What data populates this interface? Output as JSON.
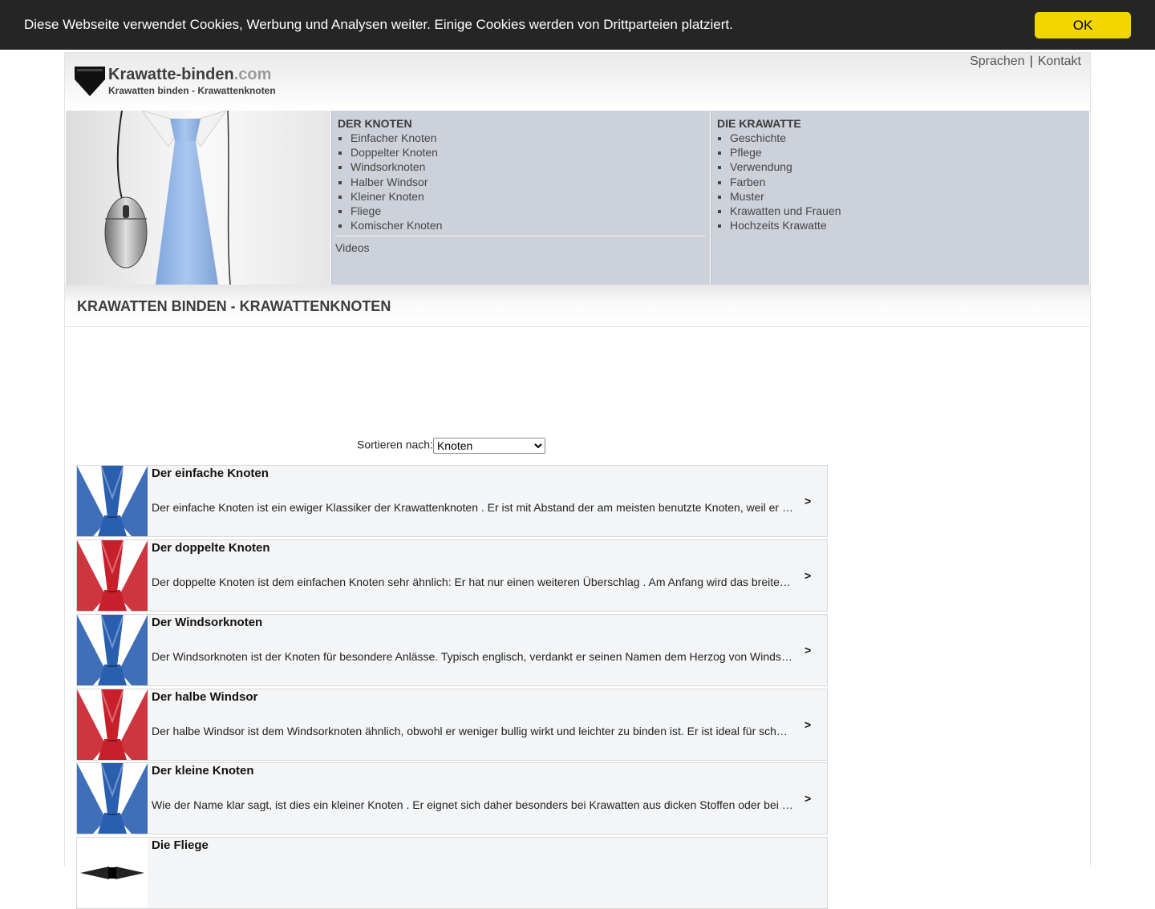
{
  "cookie": {
    "message": "Diese Webseite verwendet Cookies, Werbung und Analysen weiter. Einige Cookies werden von Drittparteien platziert.",
    "ok_label": "OK"
  },
  "header": {
    "site_name": "Krawatte-binden",
    "site_tld": ".com",
    "tagline": "Krawatten binden - Krawattenknoten",
    "links": {
      "languages": "Sprachen",
      "separator": "|",
      "contact": "Kontakt"
    }
  },
  "nav": {
    "knoten": {
      "title": "DER KNOTEN",
      "items": [
        "Einfacher Knoten",
        "Doppelter Knoten",
        "Windsorknoten",
        "Halber Windsor",
        "Kleiner Knoten",
        "Fliege",
        "Komischer Knoten"
      ],
      "videos": "Videos"
    },
    "krawatte": {
      "title": "DIE KRAWATTE",
      "items": [
        "Geschichte",
        "Pflege",
        "Verwendung",
        "Farben",
        "Muster",
        "Krawatten und Frauen",
        "Hochzeits Krawatte"
      ]
    }
  },
  "main": {
    "title": "KRAWATTEN BINDEN - KRAWATTENKNOTEN",
    "sort": {
      "label": "Sortieren nach:",
      "selected": "Knoten"
    },
    "arrow": ">",
    "cards": [
      {
        "title": "Der einfache Knoten",
        "desc": "Der einfache Knoten ist ein ewiger Klassiker der Krawattenknoten . Er ist mit Abstand der am meisten benutzte Knoten, weil er einfach zu binden ist.",
        "color": "#2a5fb0"
      },
      {
        "title": "Der doppelte Knoten",
        "desc": "Der doppelte Knoten ist dem einfachen Knoten sehr ähnlich: Er hat nur einen weiteren Überschlag . Am Anfang wird das breite Ende umgeschlagen.",
        "color": "#c8202a"
      },
      {
        "title": "Der Windsorknoten",
        "desc": "Der Windsorknoten ist der Knoten für besondere Anlässe. Typisch englisch, verdankt er seinen Namen dem Herzog von Windsor.",
        "color": "#2a5fb0"
      },
      {
        "title": "Der halbe Windsor",
        "desc": "Der halbe Windsor ist dem Windsorknoten ähnlich, obwohl er weniger bullig wirkt und leichter zu binden ist. Er ist ideal für schmale Kragen.",
        "color": "#c8202a"
      },
      {
        "title": "Der kleine Knoten",
        "desc": "Wie der Name klar sagt, ist dies ein kleiner Knoten . Er eignet sich daher besonders bei Krawatten aus dicken Stoffen oder bei kleinen Kragen.",
        "color": "#2a5fb0"
      },
      {
        "title": "Die Fliege",
        "desc": "",
        "color": "#222222"
      }
    ]
  }
}
